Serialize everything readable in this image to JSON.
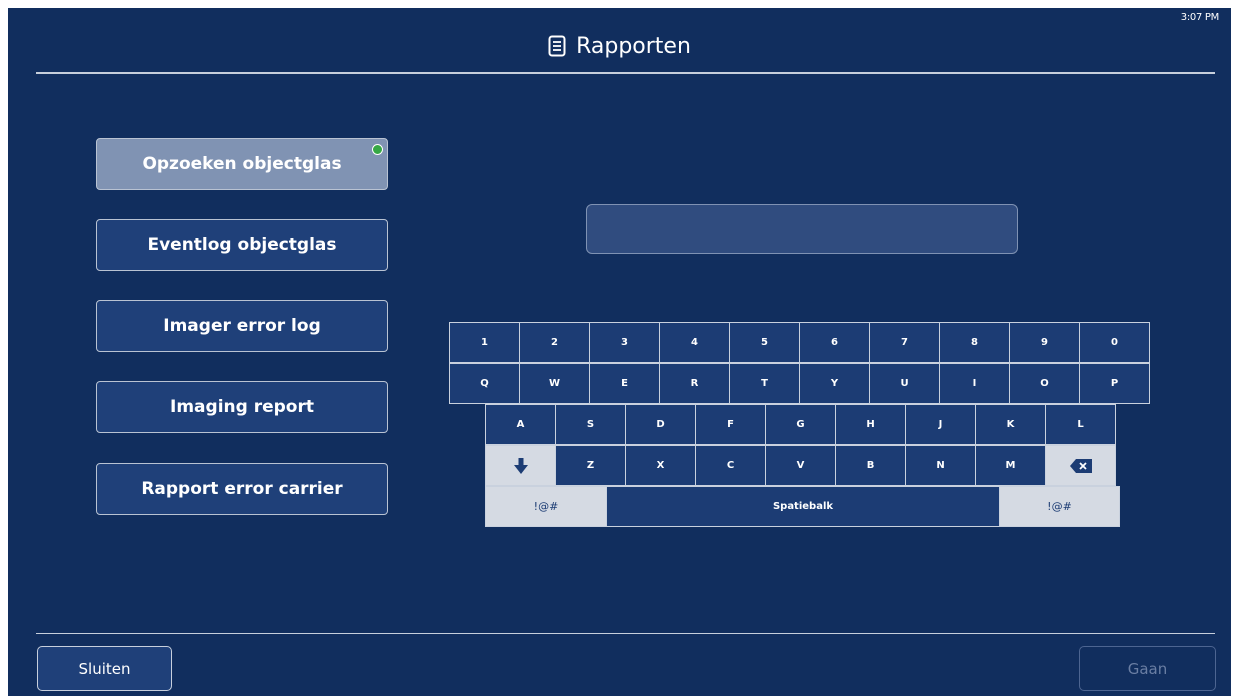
{
  "status_bar": {
    "time": "3:07 PM"
  },
  "header": {
    "title": "Rapporten",
    "icon": "document-icon"
  },
  "menu": {
    "items": [
      {
        "label": "Opzoeken objectglas",
        "active": true,
        "status_color": "#36a845"
      },
      {
        "label": "Eventlog objectglas",
        "active": false
      },
      {
        "label": "Imager error log",
        "active": false
      },
      {
        "label": "Imaging report",
        "active": false
      },
      {
        "label": "Rapport error carrier",
        "active": false
      }
    ]
  },
  "search": {
    "value": "",
    "placeholder": ""
  },
  "keyboard": {
    "row1": [
      "1",
      "2",
      "3",
      "4",
      "5",
      "6",
      "7",
      "8",
      "9",
      "0"
    ],
    "row2": [
      "Q",
      "W",
      "E",
      "R",
      "T",
      "Y",
      "U",
      "I",
      "O",
      "P"
    ],
    "row3": [
      "A",
      "S",
      "D",
      "F",
      "G",
      "H",
      "J",
      "K",
      "L"
    ],
    "row4": [
      "Z",
      "X",
      "C",
      "V",
      "B",
      "N",
      "M"
    ],
    "shift_icon": "arrow-down-icon",
    "backspace_icon": "backspace-icon",
    "symbols_left": "!@#",
    "space": "Spatiebalk",
    "symbols_right": "!@#"
  },
  "footer": {
    "close_label": "Sluiten",
    "go_label": "Gaan"
  },
  "colors": {
    "background": "#112e5e",
    "button": "#1f4079",
    "active_button": "#8093b3",
    "key_light": "#d5dae3"
  }
}
